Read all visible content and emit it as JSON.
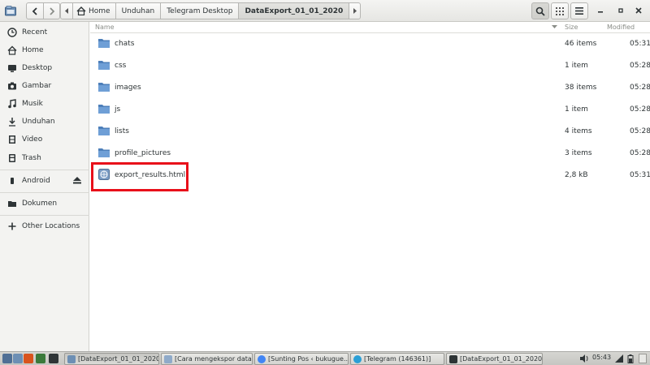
{
  "header": {
    "breadcrumbs": [
      "Home",
      "Unduhan",
      "Telegram Desktop",
      "DataExport_01_01_2020"
    ],
    "icons": {
      "back": "chevron-left-icon",
      "forward": "chevron-right-icon",
      "search": "search-icon",
      "view": "grid-view-icon",
      "menu": "hamburger-menu-icon"
    }
  },
  "sidebar": {
    "items": [
      {
        "label": "Recent",
        "icon": "clock-icon"
      },
      {
        "label": "Home",
        "icon": "home-icon"
      },
      {
        "label": "Desktop",
        "icon": "desktop-icon"
      },
      {
        "label": "Gambar",
        "icon": "camera-icon"
      },
      {
        "label": "Musik",
        "icon": "music-note-icon"
      },
      {
        "label": "Unduhan",
        "icon": "download-icon"
      },
      {
        "label": "Video",
        "icon": "film-icon"
      },
      {
        "label": "Trash",
        "icon": "trash-icon"
      }
    ],
    "devices": [
      {
        "label": "Android",
        "icon": "phone-icon"
      }
    ],
    "bookmarks": [
      {
        "label": "Dokumen",
        "icon": "folder-icon"
      }
    ],
    "other": {
      "label": "Other Locations",
      "icon": "plus-icon"
    }
  },
  "list": {
    "columns": {
      "name": "Name",
      "size": "Size",
      "modified": "Modified"
    },
    "rows": [
      {
        "name": "chats",
        "size": "46 items",
        "modified": "05:31",
        "type": "folder"
      },
      {
        "name": "css",
        "size": "1 item",
        "modified": "05:28",
        "type": "folder"
      },
      {
        "name": "images",
        "size": "38 items",
        "modified": "05:28",
        "type": "folder"
      },
      {
        "name": "js",
        "size": "1 item",
        "modified": "05:28",
        "type": "folder"
      },
      {
        "name": "lists",
        "size": "4 items",
        "modified": "05:28",
        "type": "folder"
      },
      {
        "name": "profile_pictures",
        "size": "3 items",
        "modified": "05:28",
        "type": "folder"
      },
      {
        "name": "export_results.html",
        "size": "2,8 kB",
        "modified": "05:31",
        "type": "html"
      }
    ]
  },
  "taskbar": {
    "tasks": [
      {
        "label": "[DataExport_01_01_2020]"
      },
      {
        "label": "[Cara mengekspor data ..."
      },
      {
        "label": "[Sunting Pos ‹ bukugue...."
      },
      {
        "label": "[Telegram (146361)]"
      },
      {
        "label": "[DataExport_01_01_2020]"
      }
    ],
    "clock": "05:43"
  },
  "colors": {
    "highlight": "#e8101a",
    "folder": "#5b8fc9"
  }
}
